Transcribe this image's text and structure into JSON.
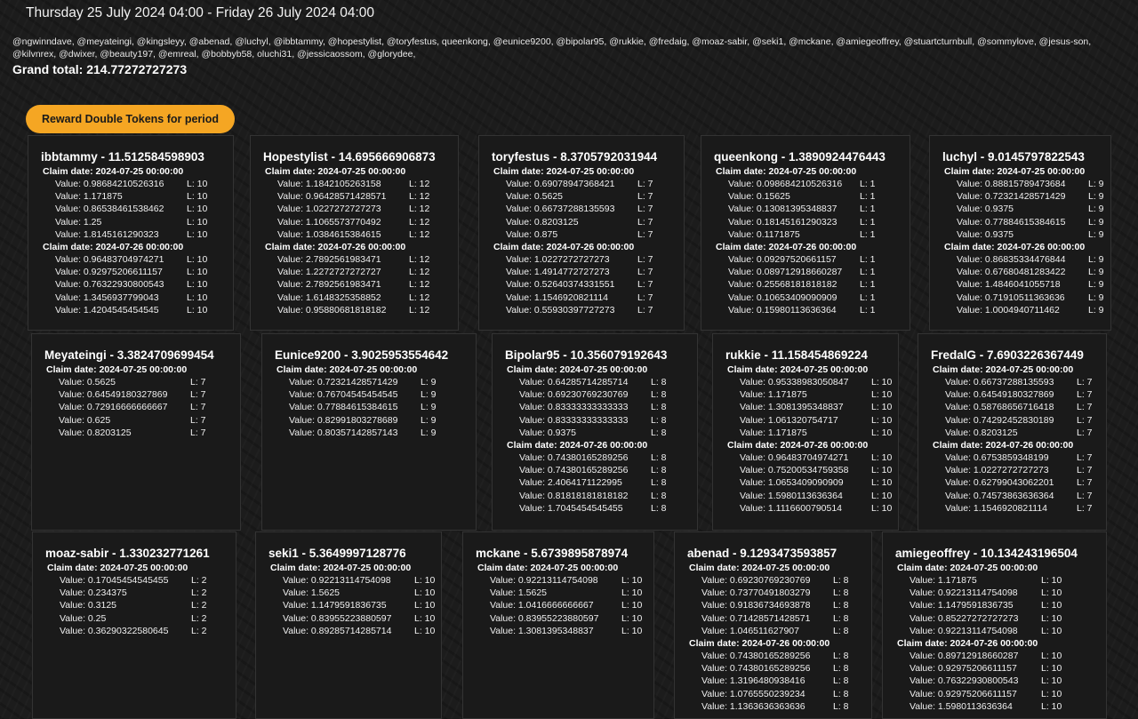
{
  "period": "Thursday 25 July 2024 04:00 - Friday 26 July 2024 04:00",
  "users": "@ngwinndave, @meyateingi, @kingsleyy, @abenad, @luchyl, @ibbtammy, @hopestylist, @toryfestus, queenkong, @eunice9200, @bipolar95, @rukkie, @fredaig, @moaz-sabir, @seki1, @mckane, @amiegeoffrey, @stuartcturnbull, @sommylove, @jesus-son, @kilvnrex, @dwixer, @beauty197, @emreal, @bobbyb58, oluchi31, @jessicaossom, @glorydee,",
  "grand_total": "Grand total: 214.77272727273",
  "reward_button": "Reward Double Tokens for period",
  "claim_prefix": "Claim date:",
  "value_prefix": "Value:",
  "level_prefix": "L:",
  "cards": [
    {
      "title": "ibbtammy - 11.512584598903",
      "claims": [
        {
          "date": "2024-07-25 00:00:00",
          "rows": [
            [
              "0.98684210526316",
              "10"
            ],
            [
              "1.171875",
              "10"
            ],
            [
              "0.86538461538462",
              "10"
            ],
            [
              "1.25",
              "10"
            ],
            [
              "1.8145161290323",
              "10"
            ]
          ]
        },
        {
          "date": "2024-07-26 00:00:00",
          "rows": [
            [
              "0.96483704974271",
              "10"
            ],
            [
              "0.92975206611157",
              "10"
            ],
            [
              "0.76322930800543",
              "10"
            ],
            [
              "1.3456937799043",
              "10"
            ],
            [
              "1.4204545454545",
              "10"
            ]
          ]
        }
      ]
    },
    {
      "title": "Hopestylist - 14.695666906873",
      "claims": [
        {
          "date": "2024-07-25 00:00:00",
          "rows": [
            [
              "1.1842105263158",
              "12"
            ],
            [
              "0.96428571428571",
              "12"
            ],
            [
              "1.0227272727273",
              "12"
            ],
            [
              "1.1065573770492",
              "12"
            ],
            [
              "1.0384615384615",
              "12"
            ]
          ]
        },
        {
          "date": "2024-07-26 00:00:00",
          "rows": [
            [
              "2.7892561983471",
              "12"
            ],
            [
              "1.2272727272727",
              "12"
            ],
            [
              "2.7892561983471",
              "12"
            ],
            [
              "1.6148325358852",
              "12"
            ],
            [
              "0.95880681818182",
              "12"
            ]
          ]
        }
      ]
    },
    {
      "title": "toryfestus - 8.3705792031944",
      "claims": [
        {
          "date": "2024-07-25 00:00:00",
          "rows": [
            [
              "0.69078947368421",
              "7"
            ],
            [
              "0.5625",
              "7"
            ],
            [
              "0.66737288135593",
              "7"
            ],
            [
              "0.8203125",
              "7"
            ],
            [
              "0.875",
              "7"
            ]
          ]
        },
        {
          "date": "2024-07-26 00:00:00",
          "rows": [
            [
              "1.0227272727273",
              "7"
            ],
            [
              "1.4914772727273",
              "7"
            ],
            [
              "0.52640374331551",
              "7"
            ],
            [
              "1.1546920821114",
              "7"
            ],
            [
              "0.55930397727273",
              "7"
            ]
          ]
        }
      ]
    },
    {
      "title": "queenkong - 1.3890924476443",
      "claims": [
        {
          "date": "2024-07-25 00:00:00",
          "rows": [
            [
              "0.098684210526316",
              "1"
            ],
            [
              "0.15625",
              "1"
            ],
            [
              "0.13081395348837",
              "1"
            ],
            [
              "0.18145161290323",
              "1"
            ],
            [
              "0.1171875",
              "1"
            ]
          ]
        },
        {
          "date": "2024-07-26 00:00:00",
          "rows": [
            [
              "0.09297520661157",
              "1"
            ],
            [
              "0.089712918660287",
              "1"
            ],
            [
              "0.25568181818182",
              "1"
            ],
            [
              "0.10653409090909",
              "1"
            ],
            [
              "0.15980113636364",
              "1"
            ]
          ]
        }
      ]
    },
    {
      "title": "luchyl - 9.0145797822543",
      "claims": [
        {
          "date": "2024-07-25 00:00:00",
          "rows": [
            [
              "0.88815789473684",
              "9"
            ],
            [
              "0.72321428571429",
              "9"
            ],
            [
              "0.9375",
              "9"
            ],
            [
              "0.77884615384615",
              "9"
            ],
            [
              "0.9375",
              "9"
            ]
          ]
        },
        {
          "date": "2024-07-26 00:00:00",
          "rows": [
            [
              "0.86835334476844",
              "9"
            ],
            [
              "0.67680481283422",
              "9"
            ],
            [
              "1.4846041055718",
              "9"
            ],
            [
              "0.71910511363636",
              "9"
            ],
            [
              "1.0004940711462",
              "9"
            ]
          ]
        }
      ]
    },
    {
      "title": "Meyateingi - 3.3824709699454",
      "claims": [
        {
          "date": "2024-07-25 00:00:00",
          "rows": [
            [
              "0.5625",
              "7"
            ],
            [
              "0.64549180327869",
              "7"
            ],
            [
              "0.72916666666667",
              "7"
            ],
            [
              "0.625",
              "7"
            ],
            [
              "0.8203125",
              "7"
            ]
          ]
        }
      ]
    },
    {
      "title": "Eunice9200 - 3.9025953554642",
      "claims": [
        {
          "date": "2024-07-25 00:00:00",
          "rows": [
            [
              "0.72321428571429",
              "9"
            ],
            [
              "0.76704545454545",
              "9"
            ],
            [
              "0.77884615384615",
              "9"
            ],
            [
              "0.82991803278689",
              "9"
            ],
            [
              "0.80357142857143",
              "9"
            ]
          ]
        }
      ]
    },
    {
      "title": "Bipolar95 - 10.356079192643",
      "claims": [
        {
          "date": "2024-07-25 00:00:00",
          "rows": [
            [
              "0.64285714285714",
              "8"
            ],
            [
              "0.69230769230769",
              "8"
            ],
            [
              "0.83333333333333",
              "8"
            ],
            [
              "0.83333333333333",
              "8"
            ],
            [
              "0.9375",
              "8"
            ]
          ]
        },
        {
          "date": "2024-07-26 00:00:00",
          "rows": [
            [
              "0.74380165289256",
              "8"
            ],
            [
              "0.74380165289256",
              "8"
            ],
            [
              "2.4064171122995",
              "8"
            ],
            [
              "0.81818181818182",
              "8"
            ],
            [
              "1.7045454545455",
              "8"
            ]
          ]
        }
      ]
    },
    {
      "title": "rukkie - 11.158454869224",
      "claims": [
        {
          "date": "2024-07-25 00:00:00",
          "rows": [
            [
              "0.95338983050847",
              "10"
            ],
            [
              "1.171875",
              "10"
            ],
            [
              "1.3081395348837",
              "10"
            ],
            [
              "1.061320754717",
              "10"
            ],
            [
              "1.171875",
              "10"
            ]
          ]
        },
        {
          "date": "2024-07-26 00:00:00",
          "rows": [
            [
              "0.96483704974271",
              "10"
            ],
            [
              "0.75200534759358",
              "10"
            ],
            [
              "1.0653409090909",
              "10"
            ],
            [
              "1.5980113636364",
              "10"
            ],
            [
              "1.1116600790514",
              "10"
            ]
          ]
        }
      ]
    },
    {
      "title": "FredaIG - 7.6903226367449",
      "claims": [
        {
          "date": "2024-07-25 00:00:00",
          "rows": [
            [
              "0.66737288135593",
              "7"
            ],
            [
              "0.64549180327869",
              "7"
            ],
            [
              "0.58768656716418",
              "7"
            ],
            [
              "0.74292452830189",
              "7"
            ],
            [
              "0.8203125",
              "7"
            ]
          ]
        },
        {
          "date": "2024-07-26 00:00:00",
          "rows": [
            [
              "0.6753859348199",
              "7"
            ],
            [
              "1.0227272727273",
              "7"
            ],
            [
              "0.62799043062201",
              "7"
            ],
            [
              "0.74573863636364",
              "7"
            ],
            [
              "1.1546920821114",
              "7"
            ]
          ]
        }
      ]
    },
    {
      "title": "moaz-sabir - 1.330232771261",
      "claims": [
        {
          "date": "2024-07-25 00:00:00",
          "rows": [
            [
              "0.17045454545455",
              "2"
            ],
            [
              "0.234375",
              "2"
            ],
            [
              "0.3125",
              "2"
            ],
            [
              "0.25",
              "2"
            ],
            [
              "0.36290322580645",
              "2"
            ]
          ]
        }
      ]
    },
    {
      "title": "seki1 - 5.3649997128776",
      "claims": [
        {
          "date": "2024-07-25 00:00:00",
          "rows": [
            [
              "0.92213114754098",
              "10"
            ],
            [
              "1.5625",
              "10"
            ],
            [
              "1.1479591836735",
              "10"
            ],
            [
              "0.83955223880597",
              "10"
            ],
            [
              "0.89285714285714",
              "10"
            ]
          ]
        }
      ]
    },
    {
      "title": "mckane - 5.6739895878974",
      "claims": [
        {
          "date": "2024-07-25 00:00:00",
          "rows": [
            [
              "0.92213114754098",
              "10"
            ],
            [
              "1.5625",
              "10"
            ],
            [
              "1.0416666666667",
              "10"
            ],
            [
              "0.83955223880597",
              "10"
            ],
            [
              "1.3081395348837",
              "10"
            ]
          ]
        }
      ]
    },
    {
      "title": "abenad - 9.1293473593857",
      "claims": [
        {
          "date": "2024-07-25 00:00:00",
          "rows": [
            [
              "0.69230769230769",
              "8"
            ],
            [
              "0.73770491803279",
              "8"
            ],
            [
              "0.91836734693878",
              "8"
            ],
            [
              "0.71428571428571",
              "8"
            ],
            [
              "1.046511627907",
              "8"
            ]
          ]
        },
        {
          "date": "2024-07-26 00:00:00",
          "rows": [
            [
              "0.74380165289256",
              "8"
            ],
            [
              "0.74380165289256",
              "8"
            ],
            [
              "1.3196480938416",
              "8"
            ],
            [
              "1.0765550239234",
              "8"
            ],
            [
              "1.1363636363636",
              "8"
            ]
          ]
        }
      ]
    },
    {
      "title": "amiegeoffrey - 10.134243196504",
      "claims": [
        {
          "date": "2024-07-25 00:00:00",
          "rows": [
            [
              "1.171875",
              "10"
            ],
            [
              "0.92213114754098",
              "10"
            ],
            [
              "1.1479591836735",
              "10"
            ],
            [
              "0.85227272727273",
              "10"
            ],
            [
              "0.92213114754098",
              "10"
            ]
          ]
        },
        {
          "date": "2024-07-26 00:00:00",
          "rows": [
            [
              "0.89712918660287",
              "10"
            ],
            [
              "0.92975206611157",
              "10"
            ],
            [
              "0.76322930800543",
              "10"
            ],
            [
              "0.92975206611157",
              "10"
            ],
            [
              "1.5980113636364",
              "10"
            ]
          ]
        }
      ]
    }
  ]
}
